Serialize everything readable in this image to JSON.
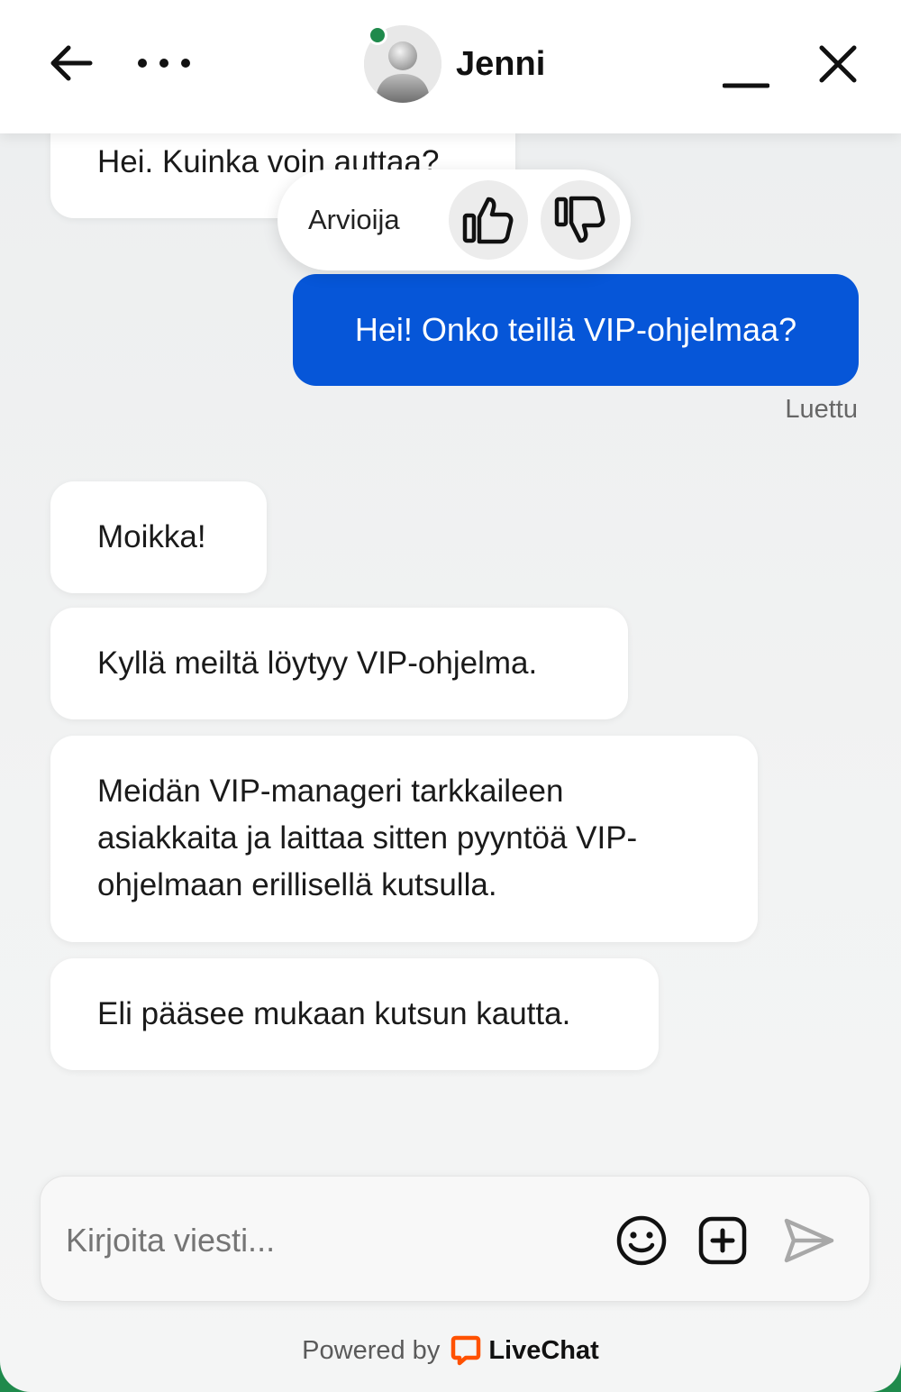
{
  "header": {
    "agent_name": "Jenni"
  },
  "rating": {
    "label": "Arvioija"
  },
  "messages": {
    "agent_greeting": "Hei. Kuinka voin auttaa?",
    "user_message": "Hei! Onko teillä VIP-ohjelmaa?",
    "read_status": "Luettu",
    "agent_replies": [
      "Moikka!",
      "Kyllä meiltä löytyy VIP-ohjelma.",
      "Meidän VIP-manageri tarkkaileen asiakkaita ja laittaa sitten pyyntöä VIP-ohjelmaan erillisellä kutsulla.",
      "Eli pääsee mukaan kutsun kautta."
    ]
  },
  "composer": {
    "placeholder": "Kirjoita viesti..."
  },
  "footer": {
    "powered_by": "Powered by",
    "brand": "LiveChat"
  },
  "colors": {
    "accent": "#0656d8",
    "status_online": "#1f8a4c",
    "brand_logo": "#ff5100"
  },
  "icons": [
    "back-arrow-icon",
    "more-icon",
    "minimize-icon",
    "close-icon",
    "thumbs-up-icon",
    "thumbs-down-icon",
    "emoji-icon",
    "attach-icon",
    "send-icon",
    "livechat-logo-icon"
  ]
}
